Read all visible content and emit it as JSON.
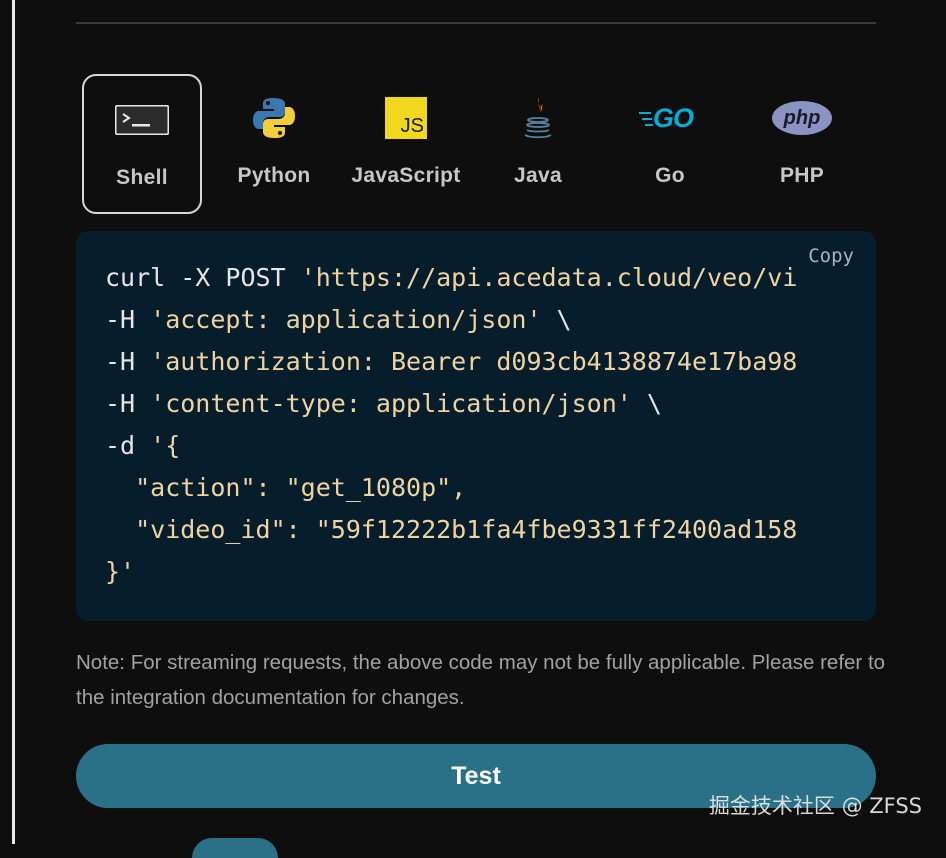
{
  "tabs": [
    {
      "label": "Shell",
      "icon": "terminal-icon"
    },
    {
      "label": "Python",
      "icon": "python-icon"
    },
    {
      "label": "JavaScript",
      "icon": "javascript-icon",
      "badge_text": "JS"
    },
    {
      "label": "Java",
      "icon": "java-icon"
    },
    {
      "label": "Go",
      "icon": "go-icon",
      "badge_text": "GO"
    },
    {
      "label": "PHP",
      "icon": "php-icon",
      "badge_text": "php"
    }
  ],
  "active_tab": "Shell",
  "code": {
    "copy_label": "Copy",
    "lines": [
      [
        "curl -X POST ",
        "'https://api.acedata.cloud/veo/vi"
      ],
      [
        "-H ",
        "'accept: application/json'",
        " \\"
      ],
      [
        "-H ",
        "'authorization: Bearer d093cb4138874e17ba98"
      ],
      [
        "-H ",
        "'content-type: application/json'",
        " \\"
      ],
      [
        "-d ",
        "'{"
      ],
      [
        "",
        "  \"action\": \"get_1080p\","
      ],
      [
        "",
        "  \"video_id\": \"59f12222b1fa4fbe9331ff2400ad158"
      ],
      [
        "",
        "}'"
      ]
    ]
  },
  "note": "Note: For streaming requests, the above code may not be fully applicable. Please refer to the integration documentation for changes.",
  "test_button": "Test",
  "watermark": "掘金技术社区 @ ZFSS",
  "colors": {
    "accent": "#2a7187",
    "code_bg": "#061d2b",
    "string": "#f0d3a3"
  }
}
